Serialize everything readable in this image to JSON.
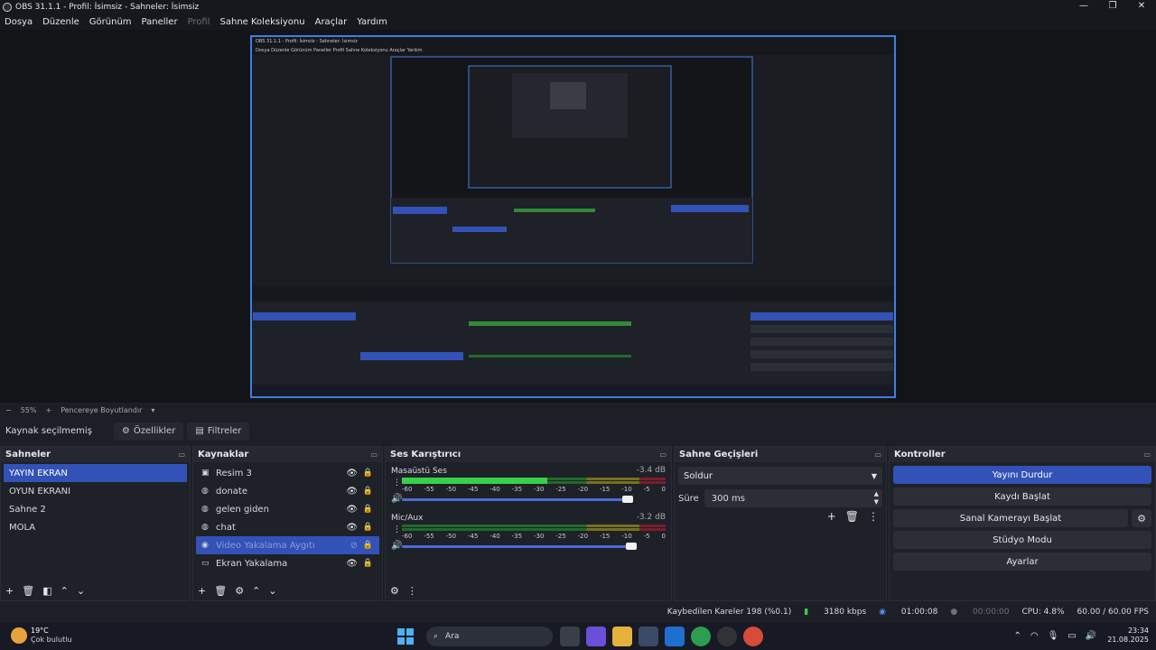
{
  "window": {
    "title": "OBS 31.1.1 - Profil: İsimsiz - Sahneler: İsimsiz",
    "controls": {
      "minimize": "—",
      "maximize": "❐",
      "close": "✕"
    }
  },
  "menu": [
    "Dosya",
    "Düzenle",
    "Görünüm",
    "Paneller",
    "Profil",
    "Sahne Koleksiyonu",
    "Araçlar",
    "Yardım"
  ],
  "zoom": {
    "minus": "−",
    "value": "55%",
    "plus": "+",
    "fit_label": "Pencereye Boyutlandır",
    "arrow": "▾"
  },
  "properties": {
    "status": "Kaynak seçilmemiş",
    "properties_btn": "Özellikler",
    "filters_btn": "Filtreler"
  },
  "scenes": {
    "title": "Sahneler",
    "items": [
      "YAYIN EKRAN",
      "OYUN EKRANI",
      "Sahne 2",
      "MOLA"
    ],
    "selected": "YAYIN EKRAN"
  },
  "sources": {
    "title": "Kaynaklar",
    "items": [
      {
        "name": "Resim 3",
        "icon": "image-icon"
      },
      {
        "name": "donate",
        "icon": "browser-icon"
      },
      {
        "name": "gelen giden",
        "icon": "browser-icon"
      },
      {
        "name": "chat",
        "icon": "browser-icon"
      },
      {
        "name": "Video Yakalama Aygıtı",
        "icon": "camera-icon",
        "selected": true,
        "hidden": true
      },
      {
        "name": "Ekran Yakalama",
        "icon": "monitor-icon"
      }
    ]
  },
  "mixer": {
    "title": "Ses Karıştırıcı",
    "channels": [
      {
        "name": "Masaüstü Ses",
        "db": "-3.4 dB",
        "level": 0.55
      },
      {
        "name": "Mic/Aux",
        "db": "-3.2 dB",
        "level": 0
      }
    ],
    "ticks": [
      "-60",
      "-55",
      "-50",
      "-45",
      "-40",
      "-35",
      "-30",
      "-25",
      "-20",
      "-15",
      "-10",
      "-5",
      "0"
    ]
  },
  "transitions": {
    "title": "Sahne Geçişleri",
    "selected": "Soldur",
    "duration_label": "Süre",
    "duration_value": "300 ms"
  },
  "controls": {
    "title": "Kontroller",
    "stop_stream": "Yayını Durdur",
    "start_record": "Kaydı Başlat",
    "virtual_cam": "Sanal Kamerayı Başlat",
    "studio_mode": "Stüdyo Modu",
    "settings": "Ayarlar"
  },
  "status": {
    "dropped": "Kaybedilen Kareler 198 (%0.1)",
    "bitrate": "3180 kbps",
    "stream_time": "01:00:08",
    "record_time": "00:00:00",
    "cpu": "CPU: 4.8%",
    "fps": "60.00 / 60.00 FPS"
  },
  "taskbar": {
    "temp": "19°C",
    "weather": "Çok bulutlu",
    "search": "Ara",
    "time": "23:34",
    "date": "21.08.2025"
  },
  "nested": {
    "menu": "Dosya  Düzenle  Görünüm  Paneller  Profil  Sahne Koleksiyonu  Araçlar  Yardım",
    "title": "OBS 31.1.1 - Profil: İsimsiz - Sahneler: İsimsiz"
  },
  "colors": {
    "accent": "#3352b8",
    "preview_border": "#3f7fe0",
    "meter_green": "#38d04a"
  }
}
